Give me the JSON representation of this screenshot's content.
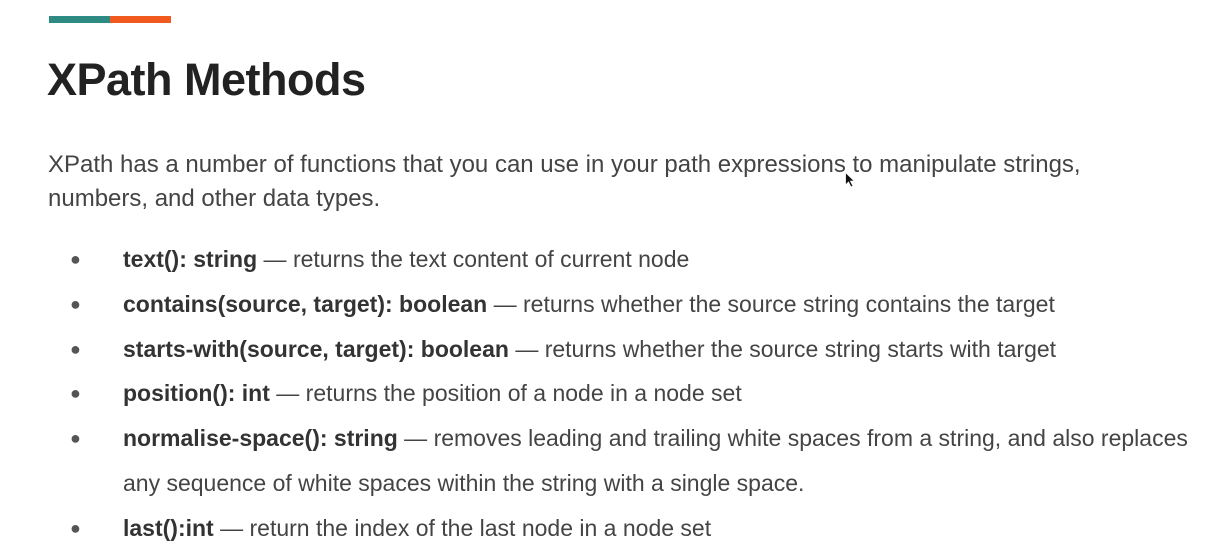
{
  "colors": {
    "accent_teal": "#2e8b84",
    "accent_orange": "#f05a1e"
  },
  "slide": {
    "title": "XPath Methods",
    "intro": "XPath has a number of functions that you can use in your path expressions to manipulate strings, numbers, and other data types.",
    "methods": [
      {
        "bullet": "●",
        "signature": "text(): string",
        "description": " — returns the text content of current node"
      },
      {
        "bullet": "●",
        "signature": "contains(source, target): boolean",
        "description": "  — returns whether the source string contains the target"
      },
      {
        "bullet": "●",
        "signature": "starts-with(source, target): boolean",
        "description": " — returns whether the source string starts with target"
      },
      {
        "bullet": "●",
        "signature": "position(): int",
        "description": " —  returns the position of a node in a node set"
      },
      {
        "bullet": "●",
        "signature": "normalise-space(): string",
        "description": " —  removes leading and trailing white spaces from a string, and also replaces any sequence of white spaces within the string with a single space."
      },
      {
        "bullet": "●",
        "signature": "last():int",
        "description": "  — return the index of the last node in a node set"
      }
    ]
  },
  "cursor": {
    "icon": "mouse-pointer-icon"
  }
}
